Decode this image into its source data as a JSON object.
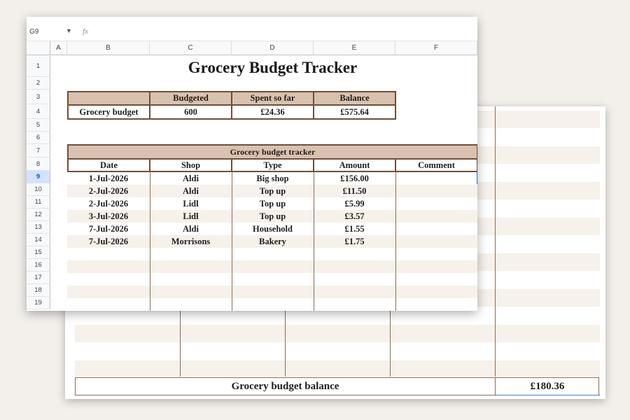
{
  "sheet": {
    "cell_ref": "G9",
    "fx_label": "fx",
    "selected_row": "9",
    "columns": [
      "A",
      "B",
      "C",
      "D",
      "E",
      "F"
    ],
    "rows": [
      "1",
      "2",
      "3",
      "4",
      "5",
      "6",
      "7",
      "8",
      "9",
      "10",
      "11",
      "12",
      "13",
      "14",
      "15",
      "16",
      "17",
      "18",
      "19"
    ]
  },
  "title": "Grocery Budget Tracker",
  "summary": {
    "headers": [
      "",
      "Budgeted",
      "Spent so far",
      "Balance"
    ],
    "row_label": "Grocery budget",
    "budgeted": "600",
    "spent": "£24.36",
    "balance": "£575.64"
  },
  "tracker": {
    "title": "Grocery budget tracker",
    "headers": [
      "Date",
      "Shop",
      "Type",
      "Amount",
      "Comment"
    ],
    "entries": [
      {
        "date": "1-Jul-2026",
        "shop": "Aldi",
        "type": "Big shop",
        "amount": "£156.00",
        "comment": ""
      },
      {
        "date": "2-Jul-2026",
        "shop": "Aldi",
        "type": "Top up",
        "amount": "£11.50",
        "comment": ""
      },
      {
        "date": "2-Jul-2026",
        "shop": "Lidl",
        "type": "Top up",
        "amount": "£5.99",
        "comment": ""
      },
      {
        "date": "3-Jul-2026",
        "shop": "Lidl",
        "type": "Top up",
        "amount": "£3.57",
        "comment": ""
      },
      {
        "date": "7-Jul-2026",
        "shop": "Aldi",
        "type": "Household",
        "amount": "£1.55",
        "comment": ""
      },
      {
        "date": "7-Jul-2026",
        "shop": "Morrisons",
        "type": "Bakery",
        "amount": "£1.75",
        "comment": ""
      }
    ]
  },
  "back": {
    "footer_label": "Grocery budget balance",
    "footer_value": "£180.36"
  },
  "colors": {
    "header_tan": "#d9c2ad",
    "border_brown": "#6e4f3b",
    "stripe": "#f6f1ea",
    "selection_blue": "#1a73e8"
  }
}
